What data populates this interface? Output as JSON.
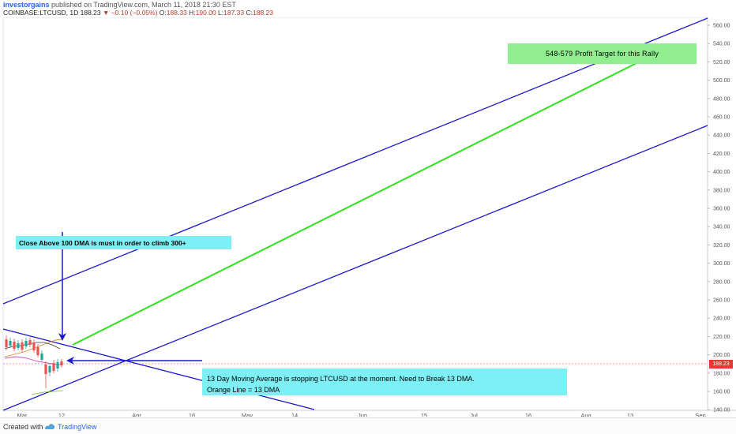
{
  "header": {
    "user": "investorgains",
    "published_text": "published on TradingView.com, March 11, 2018 21:30 EST",
    "symbol": "COINBASE:LTCUSD, 1D",
    "last": "188.23",
    "change": "−0.10 (−0.05%)",
    "o_label": "O:",
    "o_value": "188.33",
    "h_label": "H:",
    "h_value": "190.00",
    "l_label": "L:",
    "l_value": "187.33",
    "c_label": "C:",
    "c_value": "188.23"
  },
  "price_axis": {
    "labels": [
      "560.00",
      "540.00",
      "520.00",
      "500.00",
      "480.00",
      "460.00",
      "440.00",
      "420.00",
      "400.00",
      "380.00",
      "360.00",
      "340.00",
      "320.00",
      "300.00",
      "280.00",
      "260.00",
      "240.00",
      "220.00",
      "200.00",
      "180.00",
      "160.00",
      "140.00"
    ],
    "current_price": "188.23"
  },
  "time_axis": {
    "labels": [
      "Mar",
      "12",
      "Apr",
      "16",
      "May",
      "14",
      "Jun",
      "15",
      "Jul",
      "16",
      "Aug",
      "13",
      "Sep"
    ]
  },
  "annotations": {
    "profit_target": "548-579 Profit Target for this Rally",
    "close_above": "Close Above 100 DMA is must in order to climb 300+",
    "dma_line1": "13 Day Moving Average is stopping LTCUSD at the moment. Need to Break 13 DMA.",
    "dma_line2": "Orange Line = 13 DMA"
  },
  "colors": {
    "channel": "#1a1acc",
    "target_arrow": "#33dd22",
    "annotation_arrow": "#1a1acc",
    "up_candle": "#26a69a",
    "down_candle": "#ef5350",
    "price_badge": "#e53935"
  },
  "footer": {
    "created_with": "Created with",
    "brand": "TradingView"
  }
}
